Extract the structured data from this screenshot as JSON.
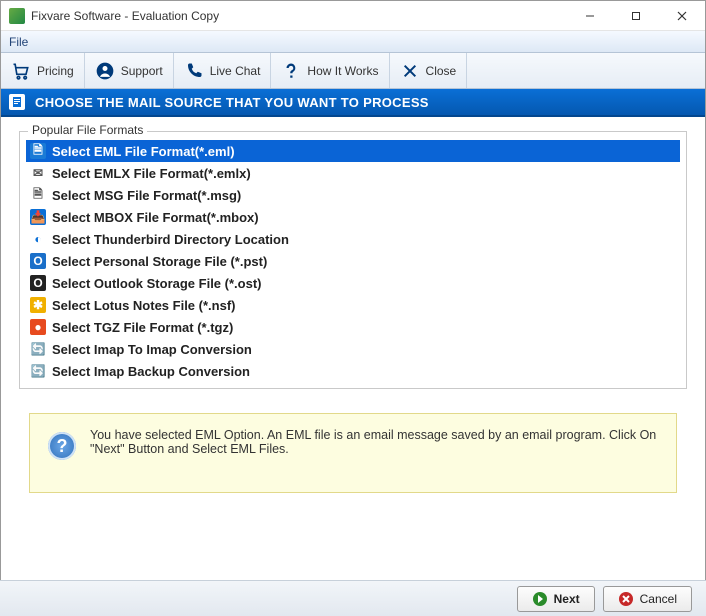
{
  "window": {
    "title": "Fixvare Software - Evaluation Copy"
  },
  "menubar": {
    "file": "File"
  },
  "toolbar": {
    "pricing": "Pricing",
    "support": "Support",
    "livechat": "Live Chat",
    "howitworks": "How It Works",
    "close": "Close"
  },
  "banner": {
    "text": "CHOOSE THE MAIL SOURCE THAT YOU WANT TO PROCESS"
  },
  "group": {
    "label": "Popular File Formats"
  },
  "formats": [
    {
      "label": "Select EML File Format(*.eml)",
      "icon_color": "#ffffff",
      "icon_bg": "#1a7bd6",
      "glyph": "🗎",
      "selected": true
    },
    {
      "label": "Select EMLX File Format(*.emlx)",
      "icon_color": "#555",
      "icon_bg": "#fff",
      "glyph": "✉"
    },
    {
      "label": "Select MSG File Format(*.msg)",
      "icon_color": "#555",
      "icon_bg": "#fff",
      "glyph": "🗎"
    },
    {
      "label": "Select MBOX File Format(*.mbox)",
      "icon_color": "#fff",
      "icon_bg": "#0a6fd6",
      "glyph": "📥"
    },
    {
      "label": "Select Thunderbird Directory Location",
      "icon_color": "#0a6fd6",
      "icon_bg": "#fff",
      "glyph": "◐"
    },
    {
      "label": "Select Personal Storage File (*.pst)",
      "icon_color": "#fff",
      "icon_bg": "#1a6fc9",
      "glyph": "O"
    },
    {
      "label": "Select Outlook Storage File (*.ost)",
      "icon_color": "#fff",
      "icon_bg": "#222",
      "glyph": "O"
    },
    {
      "label": "Select Lotus Notes File (*.nsf)",
      "icon_color": "#fff",
      "icon_bg": "#f0b000",
      "glyph": "✱"
    },
    {
      "label": "Select TGZ File Format (*.tgz)",
      "icon_color": "#fff",
      "icon_bg": "#e74a1f",
      "glyph": "●"
    },
    {
      "label": "Select Imap To Imap Conversion",
      "icon_color": "#1a6fc9",
      "icon_bg": "#fff",
      "glyph": "🔄"
    },
    {
      "label": "Select Imap Backup Conversion",
      "icon_color": "#1a6fc9",
      "icon_bg": "#fff",
      "glyph": "🔄"
    }
  ],
  "info": {
    "text": "You have selected EML Option. An EML file is an email message saved by an email program. Click On \"Next\" Button and Select EML Files."
  },
  "footer": {
    "next": "Next",
    "cancel": "Cancel"
  }
}
